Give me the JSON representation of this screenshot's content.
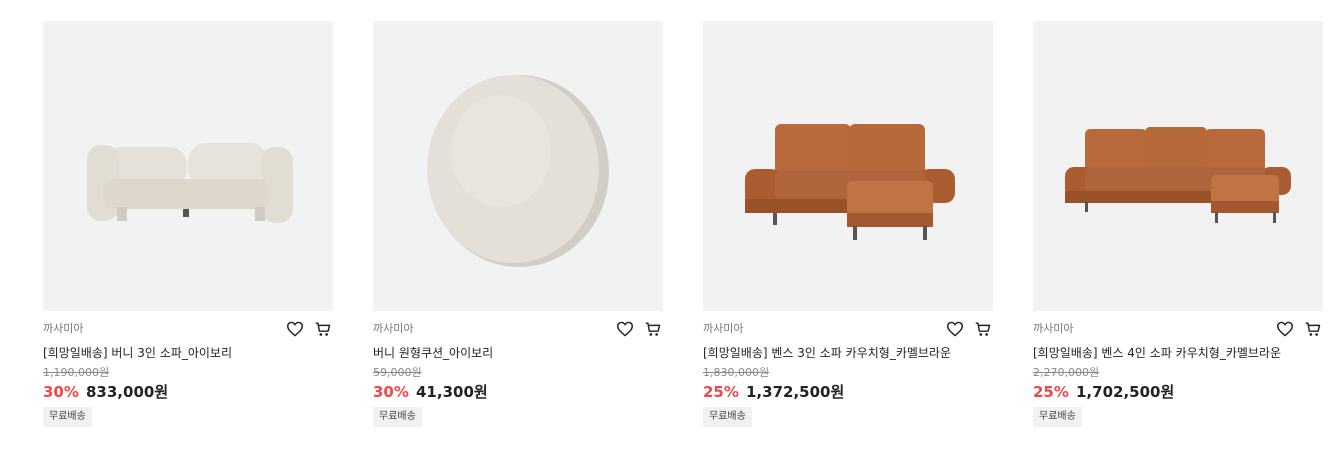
{
  "colors": {
    "discount": "#f0484a",
    "thumb_bg": "#f2f2f2",
    "tag_bg": "#f1f1f1"
  },
  "products": [
    {
      "brand": "까사미아",
      "name": "[희망일배송] 버니 3인 소파_아이보리",
      "original_price": "1,190,000원",
      "discount": "30%",
      "price": "833,000원",
      "tag": "무료배송",
      "image": "ivory-sofa"
    },
    {
      "brand": "까사미아",
      "name": "버니 원형쿠션_아이보리",
      "original_price": "59,000원",
      "discount": "30%",
      "price": "41,300원",
      "tag": "무료배송",
      "image": "round-cushion"
    },
    {
      "brand": "까사미아",
      "name": "[희망일배송] 벤스 3인 소파 카우치형_카멜브라운",
      "original_price": "1,830,000원",
      "discount": "25%",
      "price": "1,372,500원",
      "tag": "무료배송",
      "image": "camel-sofa-3"
    },
    {
      "brand": "까사미아",
      "name": "[희망일배송] 벤스 4인 소파 카우치형_카멜브라운",
      "original_price": "2,270,000원",
      "discount": "25%",
      "price": "1,702,500원",
      "tag": "무료배송",
      "image": "camel-sofa-4"
    }
  ],
  "icons": {
    "wishlist": "heart-icon",
    "cart": "cart-icon"
  }
}
